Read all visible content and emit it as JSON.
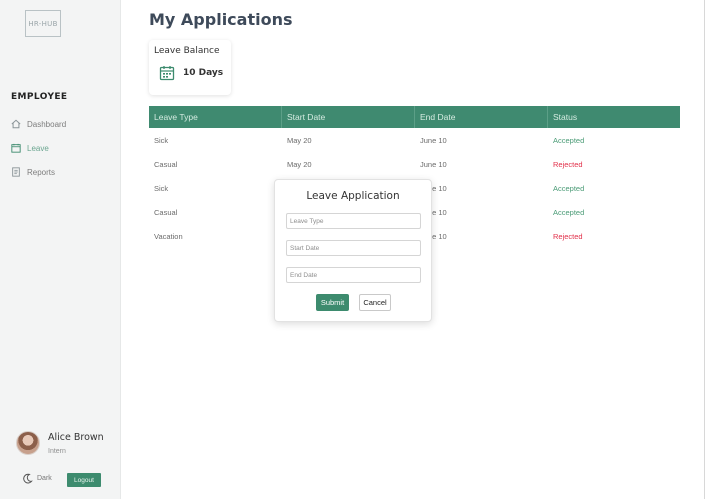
{
  "sidebar": {
    "logo": "HR-HUB",
    "heading": "EMPLOYEE",
    "items": [
      {
        "label": "Dashboard",
        "icon": "home-icon"
      },
      {
        "label": "Leave",
        "icon": "calendar-icon"
      },
      {
        "label": "Reports",
        "icon": "document-icon"
      }
    ],
    "profile": {
      "name": "Alice Brown",
      "role": "Intern"
    },
    "theme_label": "Dark",
    "logout_label": "Logout"
  },
  "main": {
    "title": "My Applications",
    "balance": {
      "title": "Leave Balance",
      "value": "10 Days",
      "icon": "calendar-icon"
    },
    "table": {
      "headers": [
        "Leave Type",
        "Start Date",
        "End Date",
        "Status"
      ],
      "rows": [
        {
          "type": "Sick",
          "start": "May 20",
          "end": "June 10",
          "status": "Accepted"
        },
        {
          "type": "Casual",
          "start": "May 20",
          "end": "June 10",
          "status": "Rejected"
        },
        {
          "type": "Sick",
          "start": "",
          "end": "June 10",
          "status": "Accepted"
        },
        {
          "type": "Casual",
          "start": "",
          "end": "June 10",
          "status": "Accepted"
        },
        {
          "type": "Vacation",
          "start": "",
          "end": "June 10",
          "status": "Rejected"
        }
      ]
    }
  },
  "modal": {
    "title": "Leave Application",
    "leave_type_placeholder": "Leave Type",
    "start_date_placeholder": "Start Date",
    "end_date_placeholder": "End Date",
    "submit_label": "Submit",
    "cancel_label": "Cancel"
  },
  "colors": {
    "accent": "#3d8b6e",
    "accepted": "#4a9b76",
    "rejected": "#e2304a",
    "title": "#3e4a5a"
  }
}
